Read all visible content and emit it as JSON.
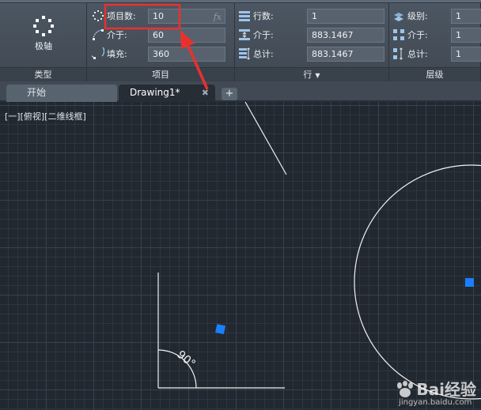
{
  "ribbon": {
    "type_panel": {
      "title": "类型",
      "polar_button_label": "极轴"
    },
    "item_panel": {
      "title": "项目",
      "fields": [
        {
          "label": "项目数:",
          "value": "10",
          "fx": "fx",
          "icon": "item-count-icon"
        },
        {
          "label": "介于:",
          "value": "60",
          "icon": "angle-between-icon"
        },
        {
          "label": "填充:",
          "value": "360",
          "icon": "fill-angle-icon"
        }
      ]
    },
    "row_panel": {
      "title": "行",
      "fields": [
        {
          "label": "行数:",
          "value": "1",
          "icon": "row-count-icon"
        },
        {
          "label": "介于:",
          "value": "883.1467",
          "icon": "row-between-icon"
        },
        {
          "label": "总计:",
          "value": "883.1467",
          "icon": "row-total-icon"
        }
      ]
    },
    "level_panel": {
      "title": "层级",
      "fields": [
        {
          "label": "级别:",
          "value": "1",
          "icon": "level-count-icon"
        },
        {
          "label": "介于:",
          "value": "1",
          "icon": "level-between-icon"
        },
        {
          "label": "总计:",
          "value": "1",
          "icon": "level-total-icon"
        }
      ]
    }
  },
  "tabs": [
    {
      "label": "开始"
    },
    {
      "label": "Drawing1*",
      "active": true
    }
  ],
  "tab_close": "✖",
  "tab_add": "+",
  "canvas": {
    "viewport_label": "[一][俯视][二维线框]",
    "angle_label": "90°"
  },
  "watermark": {
    "brand": "Bai经验",
    "url": "jingyan.baidu.com"
  },
  "colors": {
    "highlight_red": "#e8312f",
    "grip_blue": "#1a7fff",
    "canvas_bg": "#212830"
  }
}
